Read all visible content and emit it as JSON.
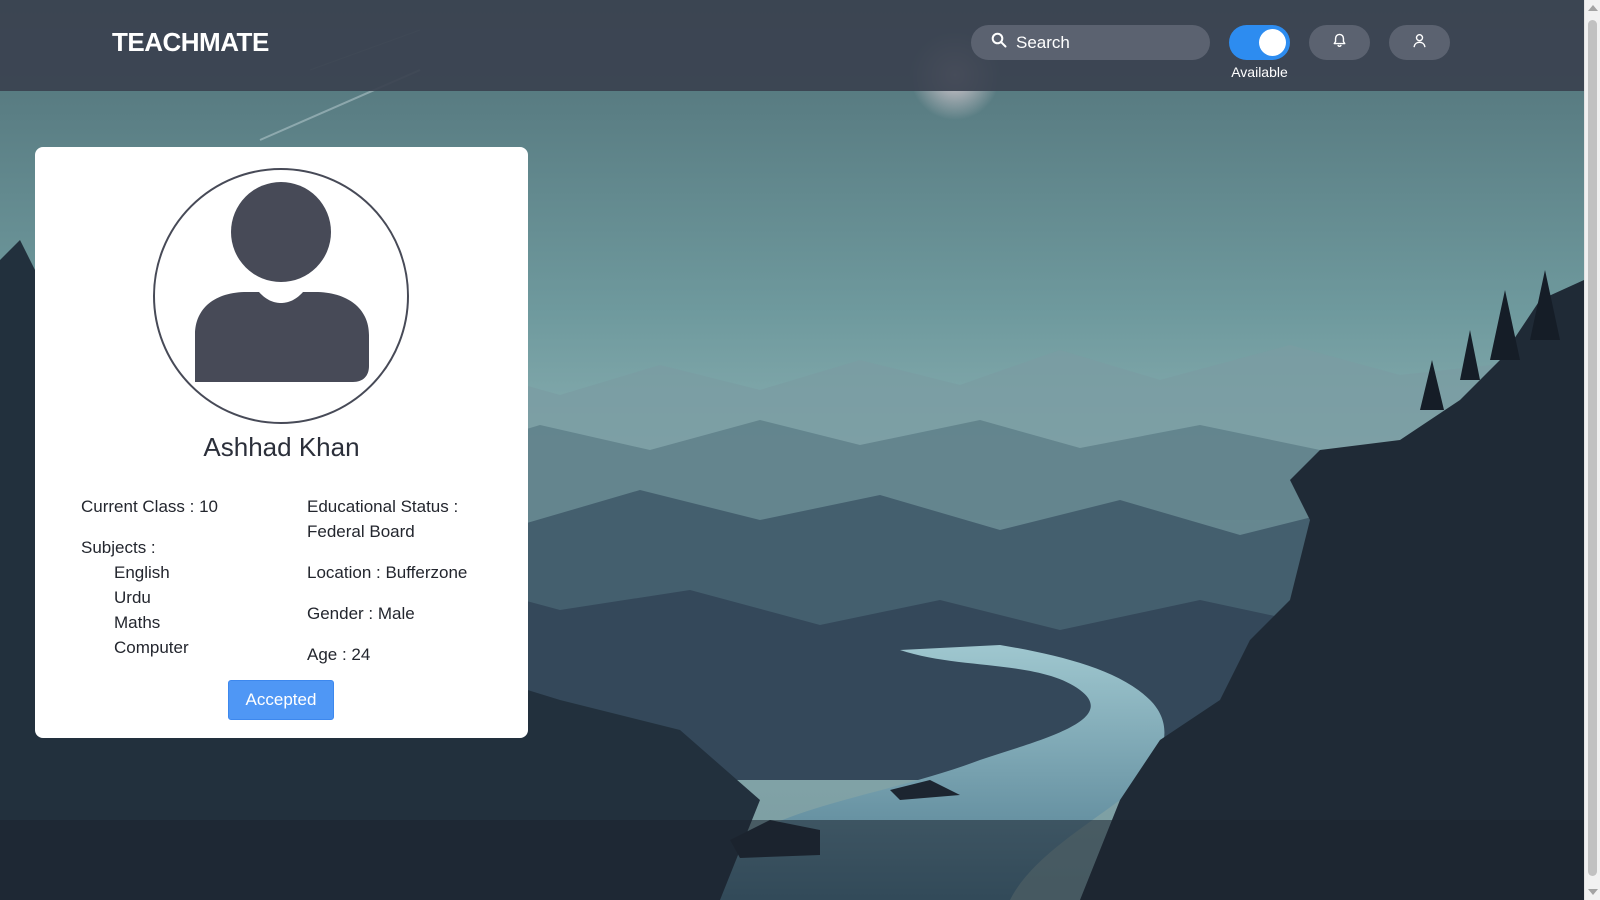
{
  "header": {
    "logo": "TEACHMATE",
    "search": {
      "placeholder": "Search",
      "value": ""
    },
    "availability_toggle": {
      "on": true,
      "label": "Available"
    },
    "icons": {
      "search": "search-icon",
      "notifications": "bell-icon",
      "profile": "user-icon"
    }
  },
  "profile_card": {
    "avatar_icon": "user-avatar-icon",
    "name": "Ashhad Khan",
    "current_class": "Current Class : 10",
    "subjects_label": "Subjects :",
    "subjects": [
      "English",
      "Urdu",
      "Maths",
      "Computer"
    ],
    "educational_status_label": "Educational Status :",
    "educational_status_value": "Federal Board",
    "location": "Location : Bufferzone",
    "gender": "Gender : Male",
    "age": "Age : 24",
    "status_button": "Accepted"
  },
  "colors": {
    "header_bg": "#3a4250",
    "accent": "#2d8cf0",
    "button": "#4f97f5",
    "card_bg": "#ffffff",
    "avatar_fill": "#474a57"
  }
}
